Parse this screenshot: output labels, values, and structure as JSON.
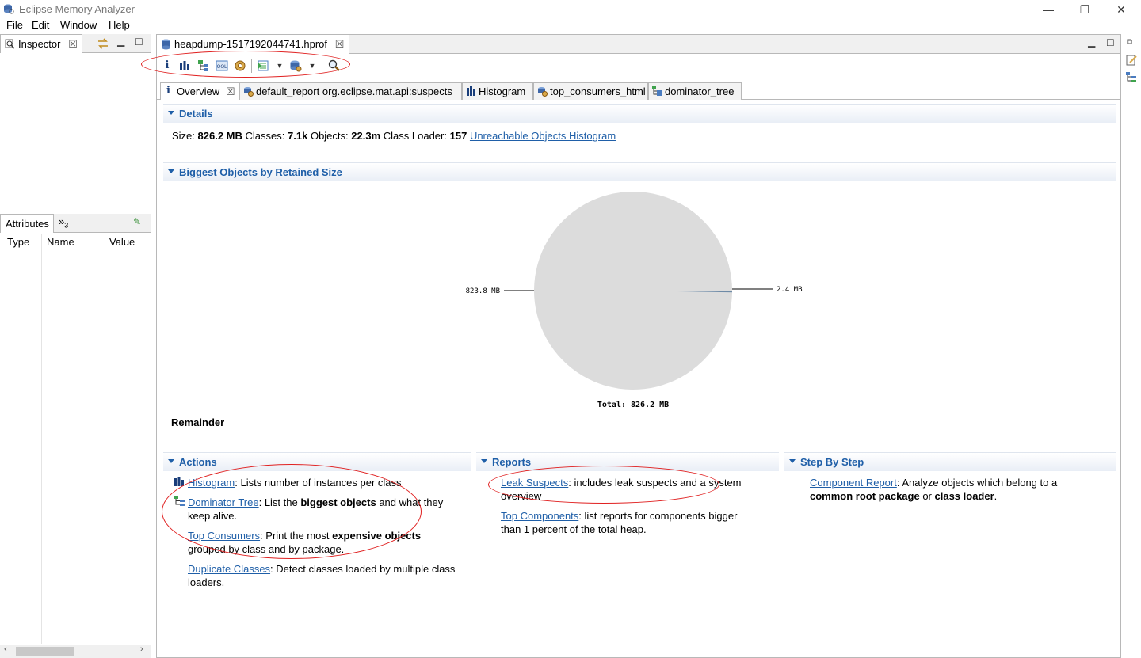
{
  "window": {
    "title": "Eclipse Memory Analyzer",
    "minimize": "—",
    "restore": "❐",
    "close": "✕"
  },
  "menu": [
    "File",
    "Edit",
    "Window",
    "Help"
  ],
  "inspector": {
    "tab_label": "Inspector",
    "close": "☒",
    "attributes_tab": "Attributes",
    "overflow_label": "»",
    "overflow_count": "3",
    "columns": [
      "Type",
      "Name",
      "Value"
    ]
  },
  "editor": {
    "file_tab": "heapdump-1517192044741.hprof",
    "close": "☒",
    "toolbar_icons": [
      "info-icon",
      "histogram-icon",
      "dominator-tree-icon",
      "oql-icon",
      "gear-icon",
      "query-browser-icon",
      "dropdown-icon",
      "heap-dump-icon",
      "dropdown-icon",
      "search-icon"
    ],
    "tabs": [
      {
        "label": "Overview",
        "icon": "info-icon",
        "active": true
      },
      {
        "label": "default_report  org.eclipse.mat.api:suspects",
        "icon": "report-icon",
        "active": false
      },
      {
        "label": "Histogram",
        "icon": "histogram-icon",
        "active": false
      },
      {
        "label": "top_consumers_html",
        "icon": "report-icon",
        "active": false
      },
      {
        "label": "dominator_tree",
        "icon": "dominator-tree-icon",
        "active": false
      }
    ]
  },
  "details": {
    "heading": "Details",
    "size_label": "Size:",
    "size_value": "826.2 MB",
    "classes_label": "Classes:",
    "classes_value": "7.1k",
    "objects_label": "Objects:",
    "objects_value": "22.3m",
    "loader_label": "Class Loader:",
    "loader_value": "157",
    "unreachable_link": "Unreachable Objects Histogram"
  },
  "biggest": {
    "heading": "Biggest Objects by Retained Size",
    "remainder_label": "Remainder"
  },
  "chart_data": {
    "type": "pie",
    "slices": [
      {
        "label": "823.8 MB",
        "value": 823.8,
        "color": "#dcdcdc"
      },
      {
        "label": "2.4 MB",
        "value": 2.4,
        "color": "#6e8aa6"
      }
    ],
    "total_label": "Total: 826.2 MB"
  },
  "actions": {
    "heading": "Actions",
    "histogram_link": "Histogram",
    "histogram_desc": ": Lists number of instances per class",
    "dominator_link": "Dominator Tree",
    "dominator_desc1": ": List the ",
    "dominator_bold": "biggest objects",
    "dominator_desc2": " and what they",
    "dominator_desc3": "keep alive.",
    "consumers_link": "Top Consumers",
    "consumers_desc1": ": Print the most ",
    "consumers_bold": "expensive objects",
    "consumers_desc2": "grouped by class and by package.",
    "duplicate_link": "Duplicate Classes",
    "duplicate_desc1": ": Detect classes loaded by multiple class",
    "duplicate_desc2": "loaders."
  },
  "reports": {
    "heading": "Reports",
    "leak_link": "Leak Suspects",
    "leak_desc1": ": includes leak suspects and a system",
    "leak_desc2": "overview",
    "components_link": "Top Components",
    "components_desc1": ": list reports for components bigger",
    "components_desc2": "than 1 percent of the total heap."
  },
  "stepbystep": {
    "heading": "Step By Step",
    "component_link": "Component Report",
    "component_desc1": ": Analyze objects which belong to a",
    "component_bold1": "common root package",
    "component_mid": " or ",
    "component_bold2": "class loader",
    "component_end": "."
  }
}
